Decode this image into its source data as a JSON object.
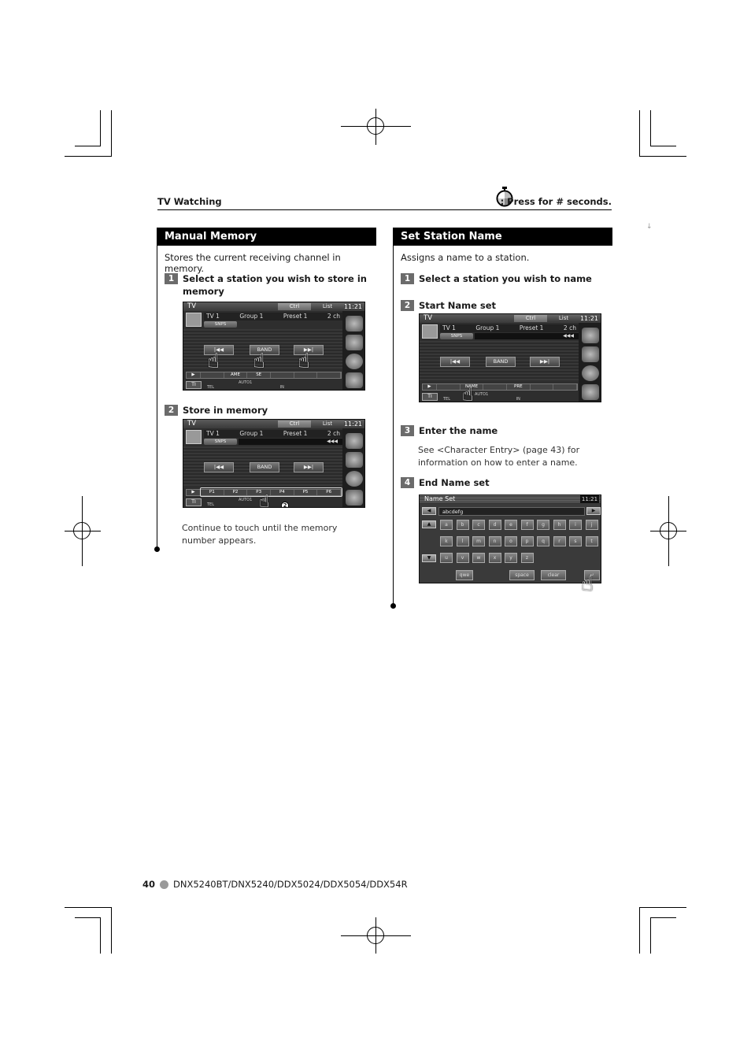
{
  "header": {
    "section_title": "TV Watching",
    "legend_icon": "stopwatch-icon",
    "legend_text": ": Press for # seconds."
  },
  "side_mark": "↓",
  "left_section": {
    "title": "Manual Memory",
    "description": "Stores the current receiving channel in memory.",
    "steps": [
      {
        "number": "1",
        "text": "Select a station you wish to store in memory"
      },
      {
        "number": "2",
        "text": "Store in memory"
      }
    ],
    "note": "Continue to touch until the memory number appears."
  },
  "right_section": {
    "title": "Set Station Name",
    "description": "Assigns a name to a station.",
    "steps": [
      {
        "number": "1",
        "text": "Select a station you wish to name"
      },
      {
        "number": "2",
        "text": "Start Name set"
      },
      {
        "number": "3",
        "text": "Enter the name"
      },
      {
        "number": "4",
        "text": "End Name set"
      }
    ],
    "note": "See <Character Entry> (page 43) for information on how to enter a name."
  },
  "tv_screen": {
    "source": "TV",
    "tabs": [
      "Ctrl",
      "List"
    ],
    "clock": "11:21",
    "info": {
      "tv": "TV  1",
      "group": "Group  1",
      "preset": "Preset 1",
      "channel": "2 ch"
    },
    "snps": "SNPS",
    "seek_indicator": "◀◀◀",
    "buttons": {
      "prev": "|◀◀",
      "band": "BAND",
      "next": "▶▶|"
    },
    "play": "▶",
    "ti": "TI",
    "status_tel": "TEL",
    "status_auto": "AUTO1",
    "status_in": "IN"
  },
  "screen1": {
    "row": [
      "",
      "AME",
      "SE",
      "",
      "",
      ""
    ]
  },
  "screen2": {
    "row": [
      "P1",
      "P2",
      "P3",
      "P4",
      "P5",
      "P6"
    ],
    "hold_badge": "2"
  },
  "screen3": {
    "row": [
      "",
      "NAME",
      "",
      "PRE",
      "",
      ""
    ]
  },
  "keyboard": {
    "title": "Name Set",
    "clock": "11:21",
    "value": "abcdefg",
    "left_arrow": "◀",
    "right_arrow": "▶",
    "up_arrow": "▲",
    "down_arrow": "▼",
    "row1": [
      "a",
      "b",
      "c",
      "d",
      "e",
      "f",
      "g",
      "h",
      "i",
      "j"
    ],
    "row2": [
      "k",
      "l",
      "m",
      "n",
      "o",
      "p",
      "q",
      "r",
      "s",
      "t"
    ],
    "row3": [
      "u",
      "v",
      "w",
      "x",
      "y",
      "z"
    ],
    "qwe": "qwe",
    "space": "space",
    "clear": "clear",
    "enter": "↵"
  },
  "footer": {
    "page_number": "40",
    "models": "DNX5240BT/DNX5240/DDX5024/DDX5054/DDX54R"
  }
}
